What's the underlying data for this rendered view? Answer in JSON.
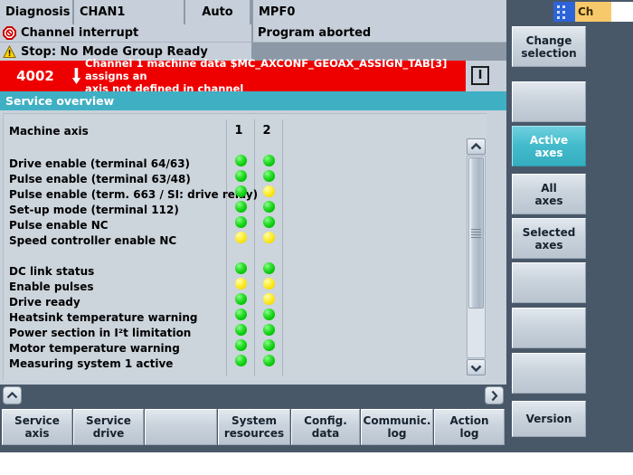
{
  "header": {
    "tabs": [
      {
        "label": "Diagnosis"
      },
      {
        "label": "CHAN1"
      },
      {
        "label": "Auto"
      },
      {
        "label": "MPF0"
      }
    ]
  },
  "status": {
    "channel_state": "Channel interrupt",
    "channel_state_icon": "stop-octagon-icon",
    "mode_state": "Stop: No Mode Group Ready",
    "mode_state_icon": "warning-triangle-icon",
    "program_state": "Program aborted"
  },
  "alarm": {
    "number": "4002",
    "arrow": "↓",
    "line1": "Channel 1 machine data $MC_AXCONF_GEOAX_ASSIGN_TAB[3] assigns an",
    "line2": "axis not defined in channel",
    "ack_button": "I",
    "color": "#ee0000"
  },
  "title_bar": {
    "text": "Service overview",
    "color": "#3fb0c4"
  },
  "table": {
    "row_header": "Machine axis",
    "columns": [
      "1",
      "2"
    ],
    "groups": [
      {
        "rows": [
          {
            "label": "Drive enable (terminal 64/63)",
            "leds": [
              "green",
              "green"
            ]
          },
          {
            "label": "Pulse enable (terminal 63/48)",
            "leds": [
              "green",
              "green"
            ]
          },
          {
            "label": "Pulse enable (term. 663 / SI: drive relay)",
            "leds": [
              "green",
              "yellow"
            ]
          },
          {
            "label": "Set-up mode (terminal 112)",
            "leds": [
              "green",
              "green"
            ]
          },
          {
            "label": "Pulse enable NC",
            "leds": [
              "green",
              "green"
            ]
          },
          {
            "label": "Speed controller enable NC",
            "leds": [
              "yellow",
              "yellow"
            ]
          }
        ]
      },
      {
        "rows": [
          {
            "label": "DC link status",
            "leds": [
              "green",
              "green"
            ]
          },
          {
            "label": "Enable pulses",
            "leds": [
              "yellow",
              "yellow"
            ]
          },
          {
            "label": "Drive ready",
            "leds": [
              "green",
              "yellow"
            ]
          },
          {
            "label": "Heatsink temperature warning",
            "leds": [
              "green",
              "green"
            ]
          },
          {
            "label": "Power section in I²t limitation",
            "leds": [
              "green",
              "green"
            ]
          },
          {
            "label": "Motor temperature warning",
            "leds": [
              "green",
              "green"
            ]
          },
          {
            "label": "Measuring system 1 active",
            "leds": [
              "green",
              "green"
            ]
          }
        ]
      }
    ]
  },
  "scrollbar": {
    "up_icon": "chevron-up-icon",
    "down_icon": "chevron-down-icon",
    "grip_icon": "grip-lines-icon"
  },
  "nav": {
    "up_icon": "chevron-up-icon",
    "right_icon": "chevron-right-icon"
  },
  "horizontal_softkeys": [
    {
      "line1": "Service",
      "line2": "axis"
    },
    {
      "line1": "Service",
      "line2": "drive"
    },
    {
      "line1": "",
      "line2": ""
    },
    {
      "line1": "System",
      "line2": "resources"
    },
    {
      "line1": "Config.",
      "line2": "data"
    },
    {
      "line1": "Communic.",
      "line2": "log"
    },
    {
      "line1": "Action",
      "line2": "log"
    }
  ],
  "vertical_softkeys": [
    {
      "line1": "Change",
      "line2": "selection",
      "active": false
    },
    {
      "line1": "",
      "line2": "",
      "active": false
    },
    {
      "line1": "Active",
      "line2": "axes",
      "active": true
    },
    {
      "line1": "All",
      "line2": "axes",
      "active": false
    },
    {
      "line1": "Selected",
      "line2": "axes",
      "active": false
    },
    {
      "line1": "",
      "line2": "",
      "active": false
    },
    {
      "line1": "",
      "line2": "",
      "active": false
    },
    {
      "line1": "",
      "line2": "",
      "active": false
    },
    {
      "line1": "Version",
      "line2": "",
      "active": false
    }
  ],
  "taskbar_tile": {
    "label": "Ch"
  }
}
